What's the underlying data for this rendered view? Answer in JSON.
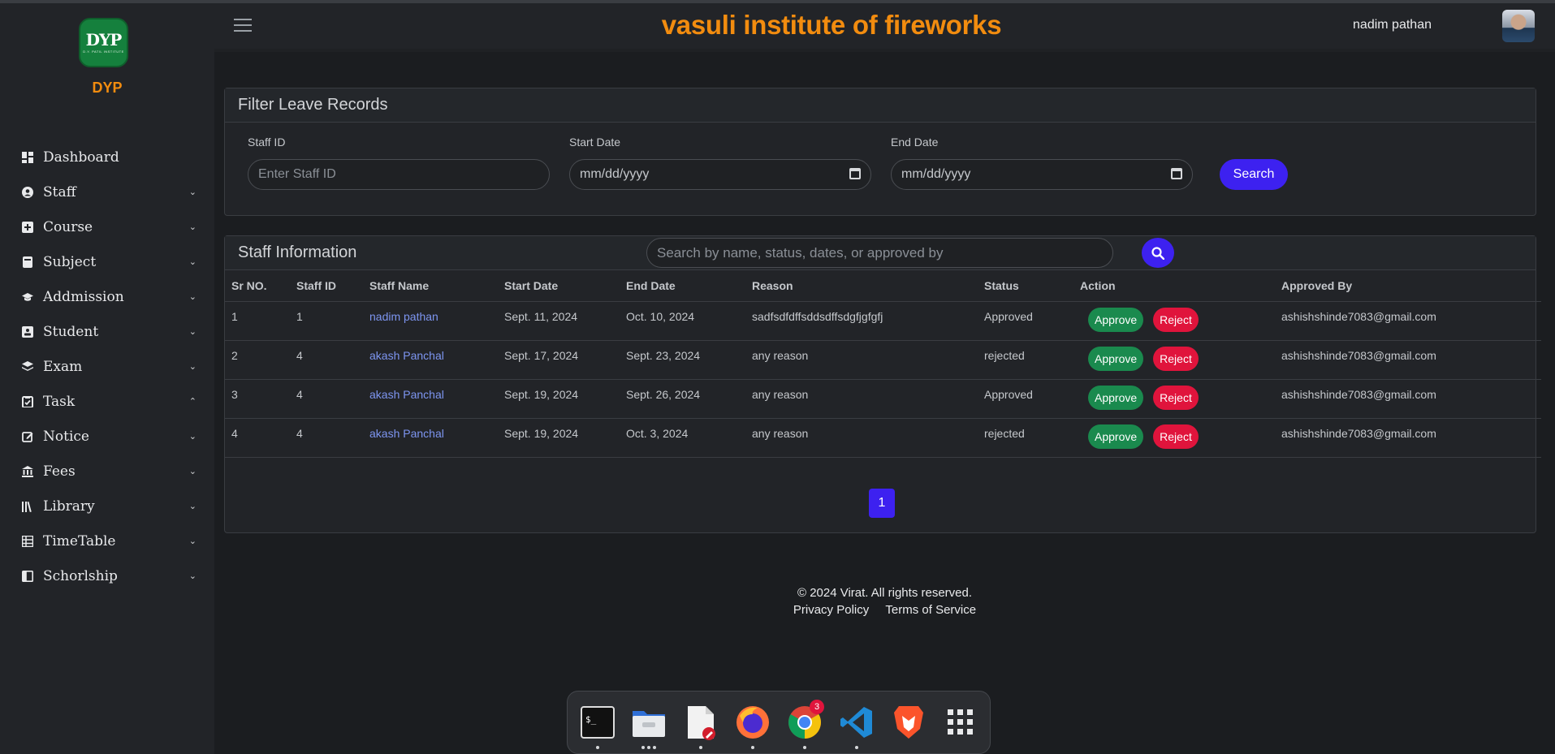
{
  "app": {
    "title": "vasuli institute of fireworks",
    "brand": "DYP",
    "logo_text": "DYP",
    "logo_subtext": "D.Y. PATIL INSTITUTE",
    "user_name": "nadim pathan"
  },
  "sidebar": {
    "items": [
      {
        "label": "Dashboard",
        "icon": "dashboard-icon",
        "chevron": ""
      },
      {
        "label": "Staff",
        "icon": "person-circle-icon",
        "chevron": "⌄"
      },
      {
        "label": "Course",
        "icon": "plus-square-icon",
        "chevron": "⌄"
      },
      {
        "label": "Subject",
        "icon": "book-icon",
        "chevron": "⌄"
      },
      {
        "label": "Addmission",
        "icon": "graduation-cap-icon",
        "chevron": "⌄"
      },
      {
        "label": "Student",
        "icon": "id-card-icon",
        "chevron": "⌄"
      },
      {
        "label": "Exam",
        "icon": "layers-icon",
        "chevron": "⌄"
      },
      {
        "label": "Task",
        "icon": "clipboard-check-icon",
        "chevron": "⌃"
      },
      {
        "label": "Notice",
        "icon": "pencil-square-icon",
        "chevron": "⌄"
      },
      {
        "label": "Fees",
        "icon": "bank-icon",
        "chevron": "⌄"
      },
      {
        "label": "Library",
        "icon": "library-icon",
        "chevron": "⌄"
      },
      {
        "label": "TimeTable",
        "icon": "table-icon",
        "chevron": "⌄"
      },
      {
        "label": "Schorlship",
        "icon": "layout-sidebar-icon",
        "chevron": "⌄"
      }
    ]
  },
  "filter": {
    "title": "Filter Leave Records",
    "staff_id_label": "Staff ID",
    "staff_id_placeholder": "Enter Staff ID",
    "start_date_label": "Start Date",
    "start_date_value": "mm/dd/yyyy",
    "end_date_label": "End Date",
    "end_date_value": "mm/dd/yyyy",
    "search_button": "Search"
  },
  "staff_info": {
    "title": "Staff Information",
    "search_placeholder": "Search by name, status, dates, or approved by",
    "columns": [
      "Sr NO.",
      "Staff ID",
      "Staff Name",
      "Start Date",
      "End Date",
      "Reason",
      "Status",
      "Action",
      "Approved By"
    ],
    "rows": [
      {
        "sr": "1",
        "staff_id": "1",
        "name": "nadim pathan",
        "start": "Sept. 11, 2024",
        "end": "Oct. 10, 2024",
        "reason": "sadfsdfdffsddsdffsdgfjgfgfj",
        "status": "Approved",
        "approve": "Approve",
        "reject": "Reject",
        "approved_by": "ashishshinde7083@gmail.com"
      },
      {
        "sr": "2",
        "staff_id": "4",
        "name": "akash Panchal",
        "start": "Sept. 17, 2024",
        "end": "Sept. 23, 2024",
        "reason": "any reason",
        "status": "rejected",
        "approve": "Approve",
        "reject": "Reject",
        "approved_by": "ashishshinde7083@gmail.com"
      },
      {
        "sr": "3",
        "staff_id": "4",
        "name": "akash Panchal",
        "start": "Sept. 19, 2024",
        "end": "Sept. 26, 2024",
        "reason": "any reason",
        "status": "Approved",
        "approve": "Approve",
        "reject": "Reject",
        "approved_by": "ashishshinde7083@gmail.com"
      },
      {
        "sr": "4",
        "staff_id": "4",
        "name": "akash Panchal",
        "start": "Sept. 19, 2024",
        "end": "Oct. 3, 2024",
        "reason": "any reason",
        "status": "rejected",
        "approve": "Approve",
        "reject": "Reject",
        "approved_by": "ashishshinde7083@gmail.com"
      }
    ],
    "page": "1"
  },
  "footer": {
    "copyright": "© 2024 Virat. All rights reserved.",
    "privacy": "Privacy Policy",
    "terms": "Terms of Service"
  },
  "dock": {
    "items": [
      "terminal-icon",
      "files-icon",
      "text-editor-icon",
      "firefox-icon",
      "chrome-icon",
      "vscode-icon",
      "brave-icon",
      "app-grid-icon"
    ],
    "chrome_badge": "3"
  },
  "colors": {
    "accent": "#3d21f0",
    "brand_orange": "#f28c0f",
    "approve": "#1a8a4e",
    "reject": "#e0143c",
    "link": "#7d95f0"
  }
}
